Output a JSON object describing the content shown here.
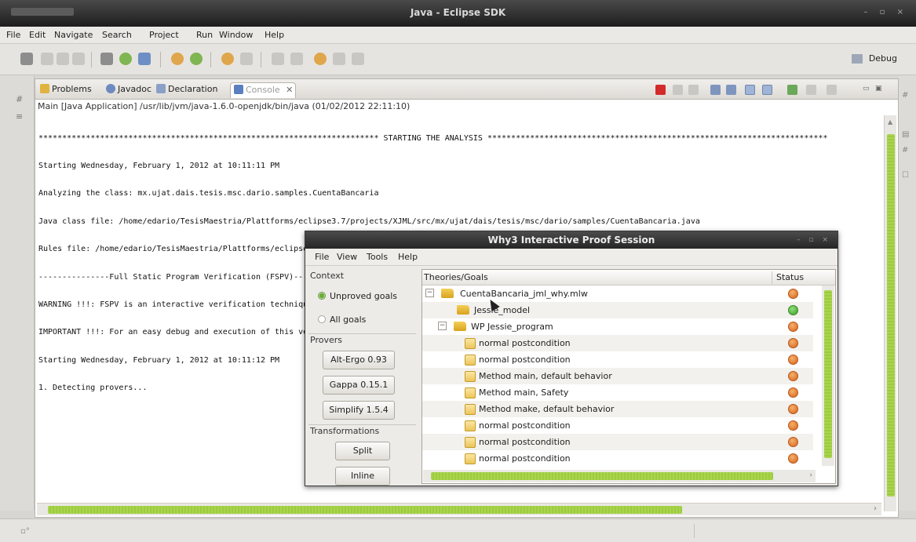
{
  "window": {
    "title": "Java - Eclipse SDK"
  },
  "menubar": {
    "items": [
      "File",
      "Edit",
      "Navigate",
      "Search",
      "Project",
      "Run",
      "Window",
      "Help"
    ]
  },
  "toolbar": {
    "perspective_label": "Debug"
  },
  "view": {
    "tabs": [
      {
        "label": "Problems",
        "icon": "problems-icon"
      },
      {
        "label": "Javadoc",
        "icon": "javadoc-icon"
      },
      {
        "label": "Declaration",
        "icon": "declaration-icon"
      },
      {
        "label": "Console",
        "icon": "console-icon",
        "active": true
      }
    ],
    "tab_close": "✕",
    "process_line": "Main [Java Application] /usr/lib/jvm/java-1.6.0-openjdk/bin/java (01/02/2012 22:11:10)",
    "console_lines": [
      "************************************************************************ STARTING THE ANALYSIS ************************************************************************",
      "Starting Wednesday, February 1, 2012 at 10:11:11 PM",
      "Analyzing the class: mx.ujat.dais.tesis.msc.dario.samples.CuentaBancaria",
      "Java class file: /home/edario/TesisMaestria/Plattforms/eclipse3.7/projects/XJML/src/mx/ujat/dais/tesis/msc/dario/samples/CuentaBancaria.java",
      "Rules file: /home/edario/TesisMaestria/Plattforms/eclipse3.7/projects/XJML/src/mx/ujat/dais/tesis/msc/dario/samples/CuentaBancaria.xml",
      "---------------Full Static Program Verification (FSPV)---------------",
      "WARNING !!!: FSPV is an interactive verification technique, so is for advanced users.",
      "IMPORTANT !!!: For an easy debug and execution of this verification tool, the file /home/edario/TesisMaestria/Plattforms/eclipse3.7/projects/XJML/t",
      "Starting Wednesday, February 1, 2012 at 10:11:12 PM",
      "1. Detecting provers..."
    ]
  },
  "why3": {
    "title": "Why3 Interactive Proof Session",
    "menu": [
      "File",
      "View",
      "Tools",
      "Help"
    ],
    "context_label": "Context",
    "context_options": [
      {
        "label": "Unproved goals",
        "selected": true
      },
      {
        "label": "All goals",
        "selected": false
      }
    ],
    "provers_label": "Provers",
    "provers": [
      "Alt-Ergo 0.93",
      "Gappa 0.15.1",
      "Simplify 1.5.4"
    ],
    "transformations_label": "Transformations",
    "transformations": [
      "Split",
      "Inline"
    ],
    "columns": {
      "goals": "Theories/Goals",
      "status": "Status"
    },
    "rows": [
      {
        "level": 0,
        "kind": "folder",
        "expander": "−",
        "label": "CuentaBancaria_jml_why.mlw",
        "status": "fail"
      },
      {
        "level": 1,
        "kind": "folder",
        "expander": "",
        "label": "Jessie_model",
        "status": "ok"
      },
      {
        "level": 1,
        "kind": "folder",
        "expander": "−",
        "label": "WP Jessie_program",
        "status": "fail"
      },
      {
        "level": 2,
        "kind": "goal",
        "label": "normal postcondition",
        "status": "fail"
      },
      {
        "level": 2,
        "kind": "goal",
        "label": "normal postcondition",
        "status": "fail"
      },
      {
        "level": 2,
        "kind": "goal",
        "label": "Method main, default behavior",
        "status": "fail"
      },
      {
        "level": 2,
        "kind": "goal",
        "label": "Method main, Safety",
        "status": "fail"
      },
      {
        "level": 2,
        "kind": "goal",
        "label": "Method make, default behavior",
        "status": "fail"
      },
      {
        "level": 2,
        "kind": "goal",
        "label": "normal postcondition",
        "status": "fail"
      },
      {
        "level": 2,
        "kind": "goal",
        "label": "normal postcondition",
        "status": "fail"
      },
      {
        "level": 2,
        "kind": "goal",
        "label": "normal postcondition",
        "status": "fail"
      }
    ],
    "colors": {
      "fail": "#d8661f",
      "ok": "#3d9c29",
      "scroll_thumb": "#a6d24a"
    }
  }
}
